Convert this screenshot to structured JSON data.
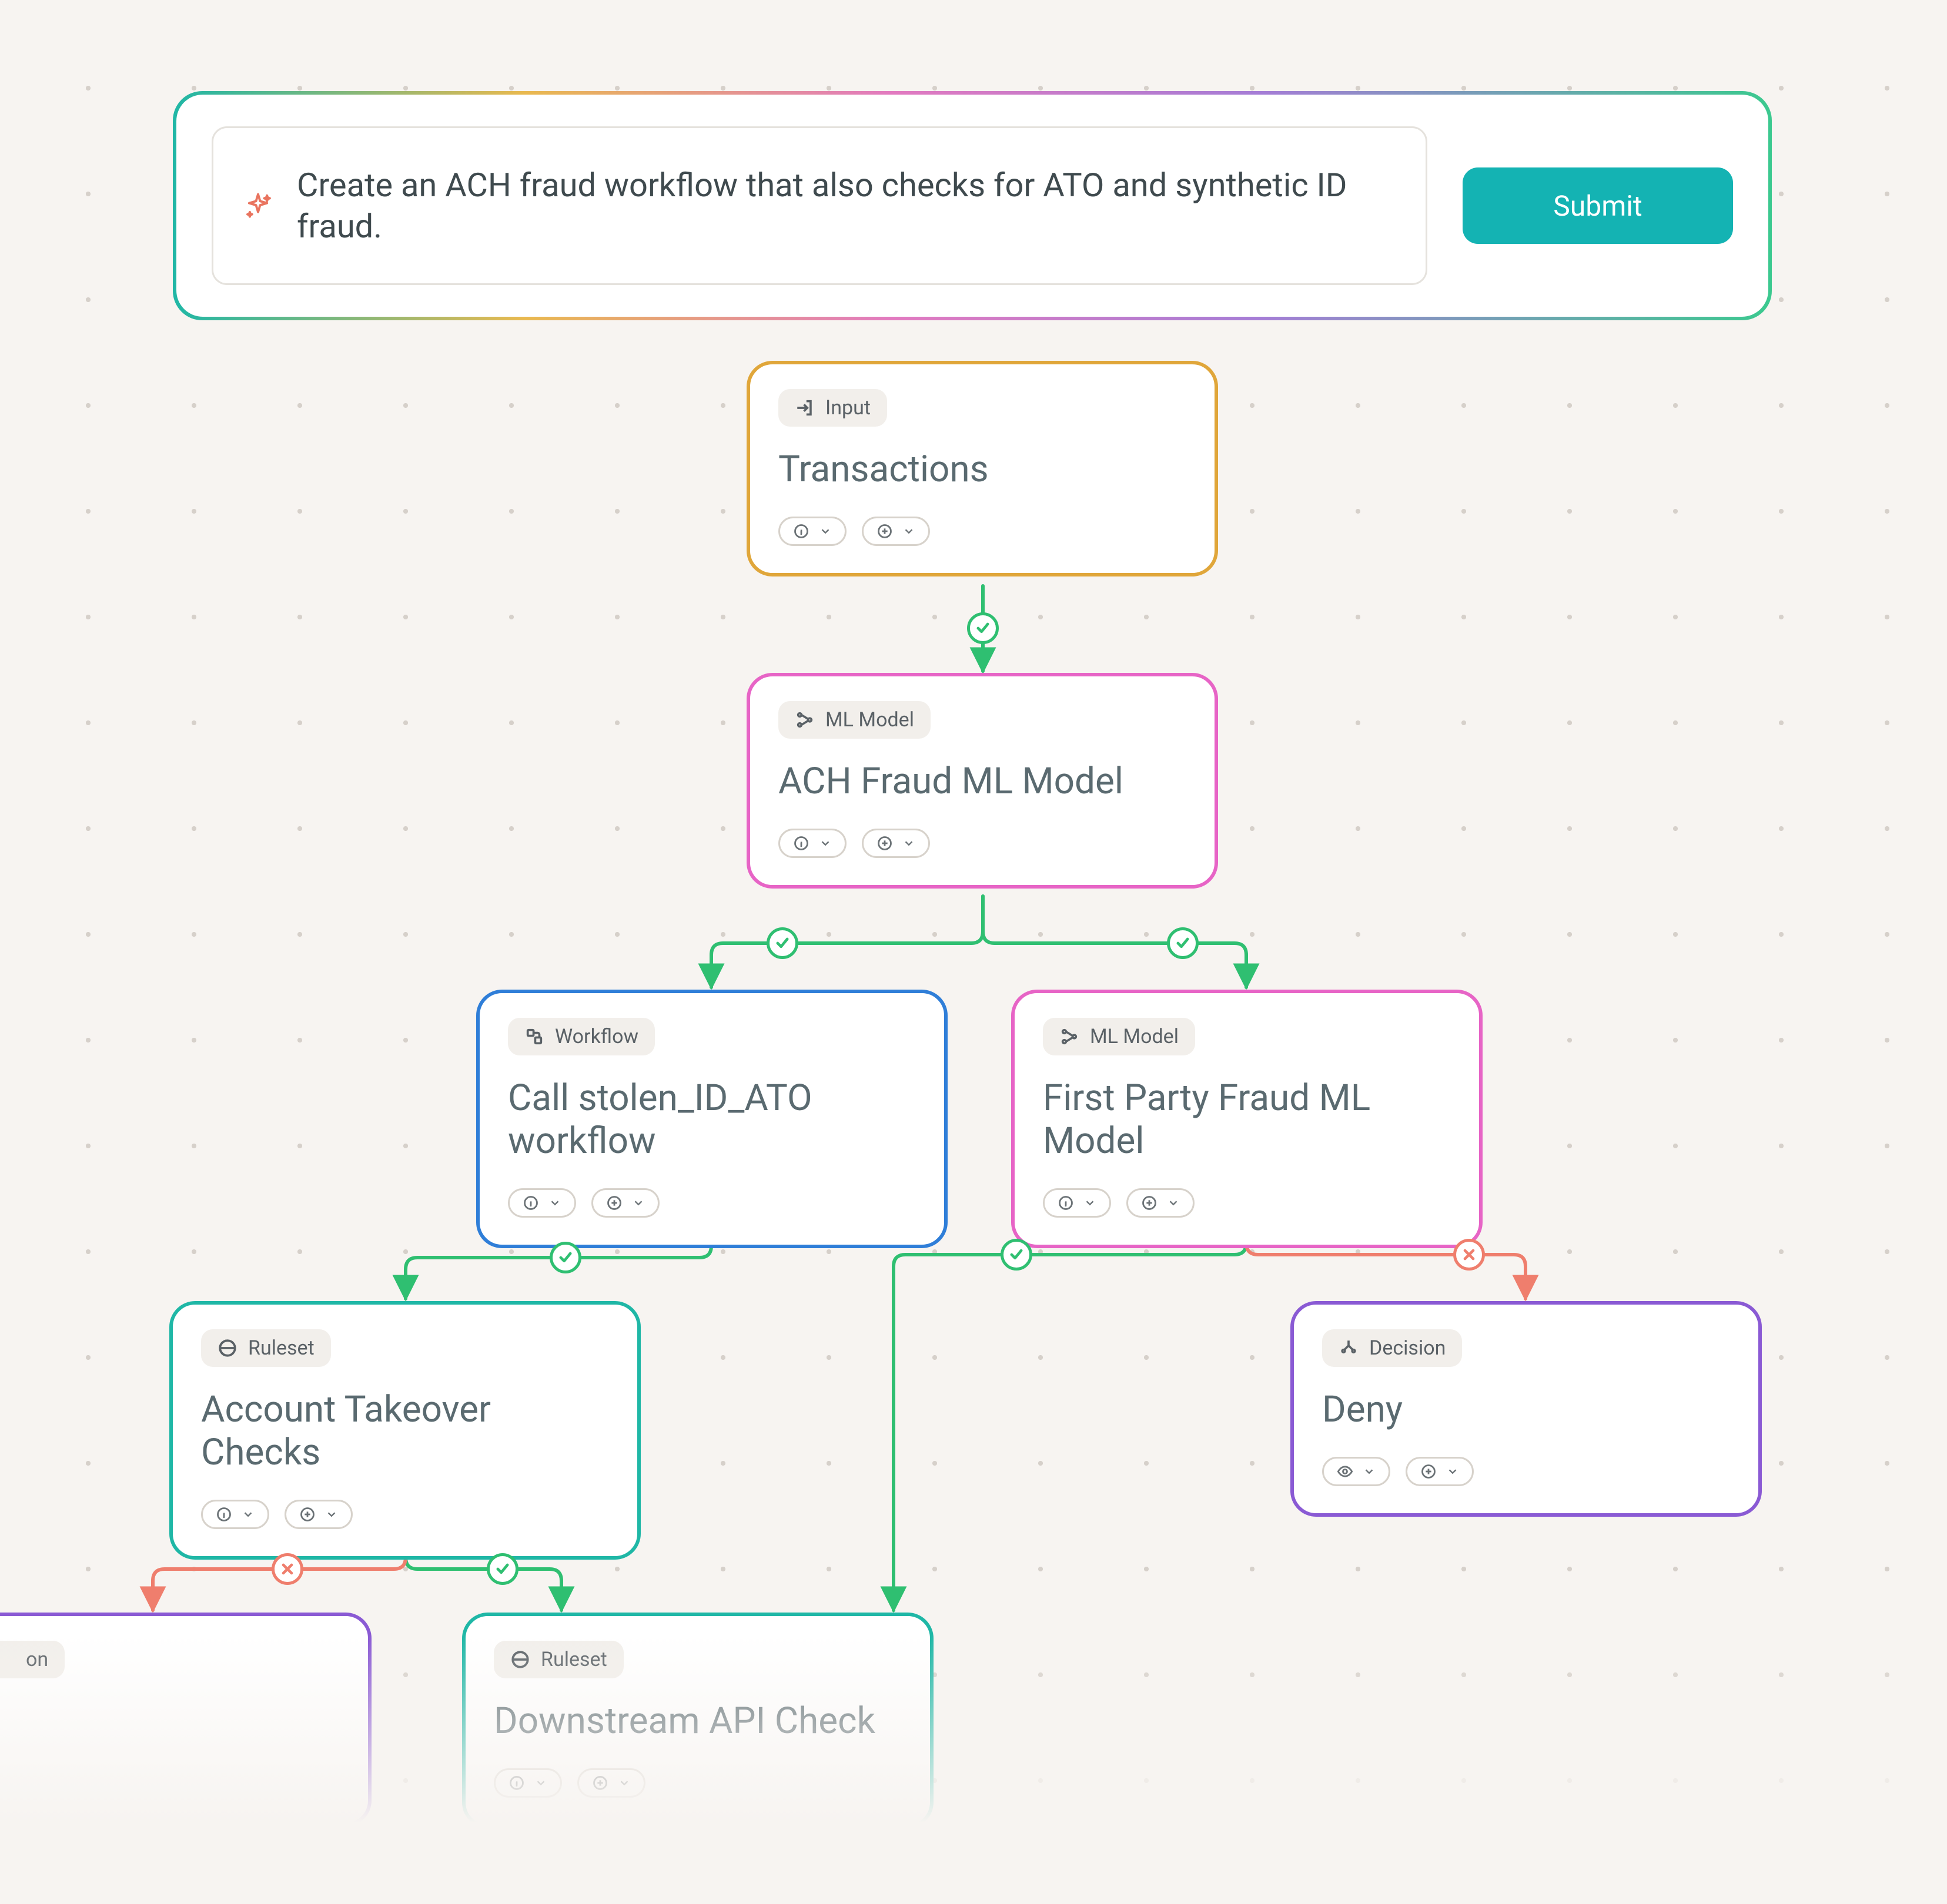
{
  "prompt": {
    "text": "Create an ACH fraud workflow that also checks for ATO and synthetic ID fraud.",
    "submit_label": "Submit"
  },
  "nodes": {
    "input": {
      "tag": "Input",
      "title": "Transactions"
    },
    "ach_model": {
      "tag": "ML Model",
      "title": "ACH Fraud ML Model"
    },
    "stolen_wf": {
      "tag": "Workflow",
      "title": "Call stolen_ID_ATO workflow"
    },
    "fp_model": {
      "tag": "ML Model",
      "title": "First Party Fraud ML Model"
    },
    "ato_checks": {
      "tag": "Ruleset",
      "title": "Account Takeover Checks"
    },
    "deny": {
      "tag": "Decision",
      "title": "Deny"
    },
    "downstream": {
      "tag": "Ruleset",
      "title": "Downstream API Check"
    },
    "partial_decision": {
      "tag_fragment": "on"
    }
  }
}
